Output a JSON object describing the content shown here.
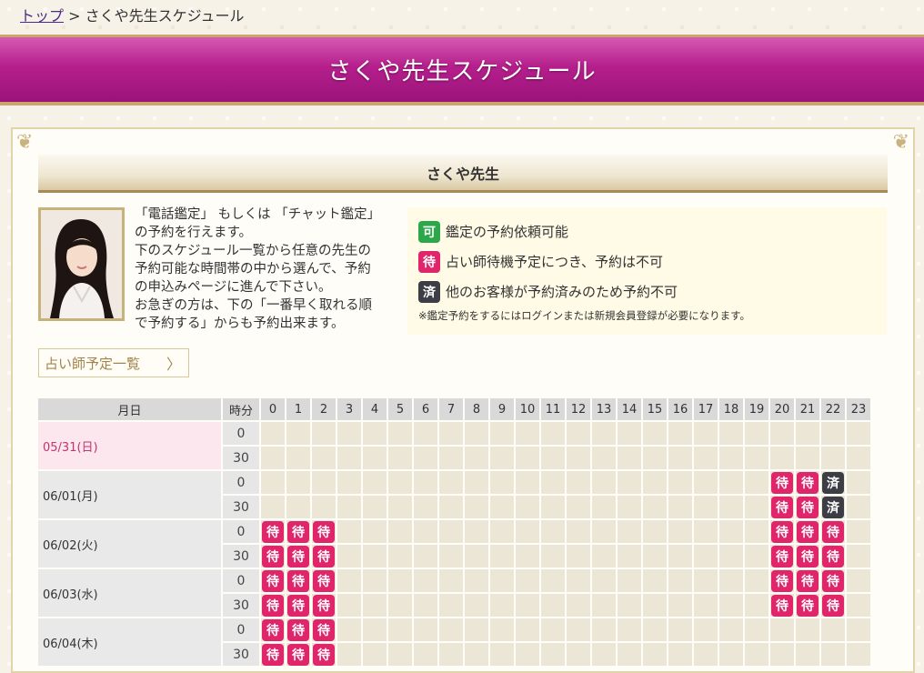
{
  "breadcrumb": {
    "home": "トップ",
    "sep": ">",
    "current": "さくや先生スケジュール"
  },
  "banner": {
    "title": "さくや先生スケジュール"
  },
  "tutor": {
    "name": "さくや先生",
    "intro": [
      "「電話鑑定」 もしくは 「チャット鑑定」",
      "の予約を行えます。",
      "下のスケジュール一覧から任意の先生の",
      "予約可能な時間帯の中から選んで、予約",
      "の申込みページに進んで下さい。",
      "お急ぎの方は、下の「一番早く取れる順",
      "で予約する」からも予約出来ます。"
    ]
  },
  "legend": {
    "items": [
      {
        "symbol": "可",
        "text": "鑑定の予約依頼可能",
        "color": "#2ca84a"
      },
      {
        "symbol": "待",
        "text": "占い師待機予定につき、予約は不可",
        "color": "#e0256b"
      },
      {
        "symbol": "済",
        "text": "他のお客様が予約済みのため予約不可",
        "color": "#3d3d45"
      }
    ],
    "note": "※鑑定予約をするにはログインまたは新規会員登録が必要になります。"
  },
  "schedule_button": {
    "label": "占い師予定一覧",
    "chevron": "〉"
  },
  "schedule": {
    "header_date": "月日",
    "header_min": "時分",
    "hours": [
      "0",
      "1",
      "2",
      "3",
      "4",
      "5",
      "6",
      "7",
      "8",
      "9",
      "10",
      "11",
      "12",
      "13",
      "14",
      "15",
      "16",
      "17",
      "18",
      "19",
      "20",
      "21",
      "22",
      "23"
    ],
    "days": [
      {
        "date": "05/31(日)",
        "today": true,
        "rows": [
          {
            "min": "0",
            "slots": {}
          },
          {
            "min": "30",
            "slots": {}
          }
        ]
      },
      {
        "date": "06/01(月)",
        "rows": [
          {
            "min": "0",
            "slots": {
              "20": "待",
              "21": "待",
              "22": "済"
            }
          },
          {
            "min": "30",
            "slots": {
              "20": "待",
              "21": "待",
              "22": "済"
            }
          }
        ]
      },
      {
        "date": "06/02(火)",
        "rows": [
          {
            "min": "0",
            "slots": {
              "0": "待",
              "1": "待",
              "2": "待",
              "20": "待",
              "21": "待",
              "22": "待"
            }
          },
          {
            "min": "30",
            "slots": {
              "0": "待",
              "1": "待",
              "2": "待",
              "20": "待",
              "21": "待",
              "22": "待"
            }
          }
        ]
      },
      {
        "date": "06/03(水)",
        "rows": [
          {
            "min": "0",
            "slots": {
              "0": "待",
              "1": "待",
              "2": "待",
              "20": "待",
              "21": "待",
              "22": "待"
            }
          },
          {
            "min": "30",
            "slots": {
              "0": "待",
              "1": "待",
              "2": "待",
              "20": "待",
              "21": "待",
              "22": "待"
            }
          }
        ]
      },
      {
        "date": "06/04(木)",
        "rows": [
          {
            "min": "0",
            "slots": {
              "0": "待",
              "1": "待",
              "2": "待"
            }
          },
          {
            "min": "30",
            "slots": {
              "0": "待",
              "1": "待",
              "2": "待"
            }
          }
        ]
      }
    ]
  }
}
